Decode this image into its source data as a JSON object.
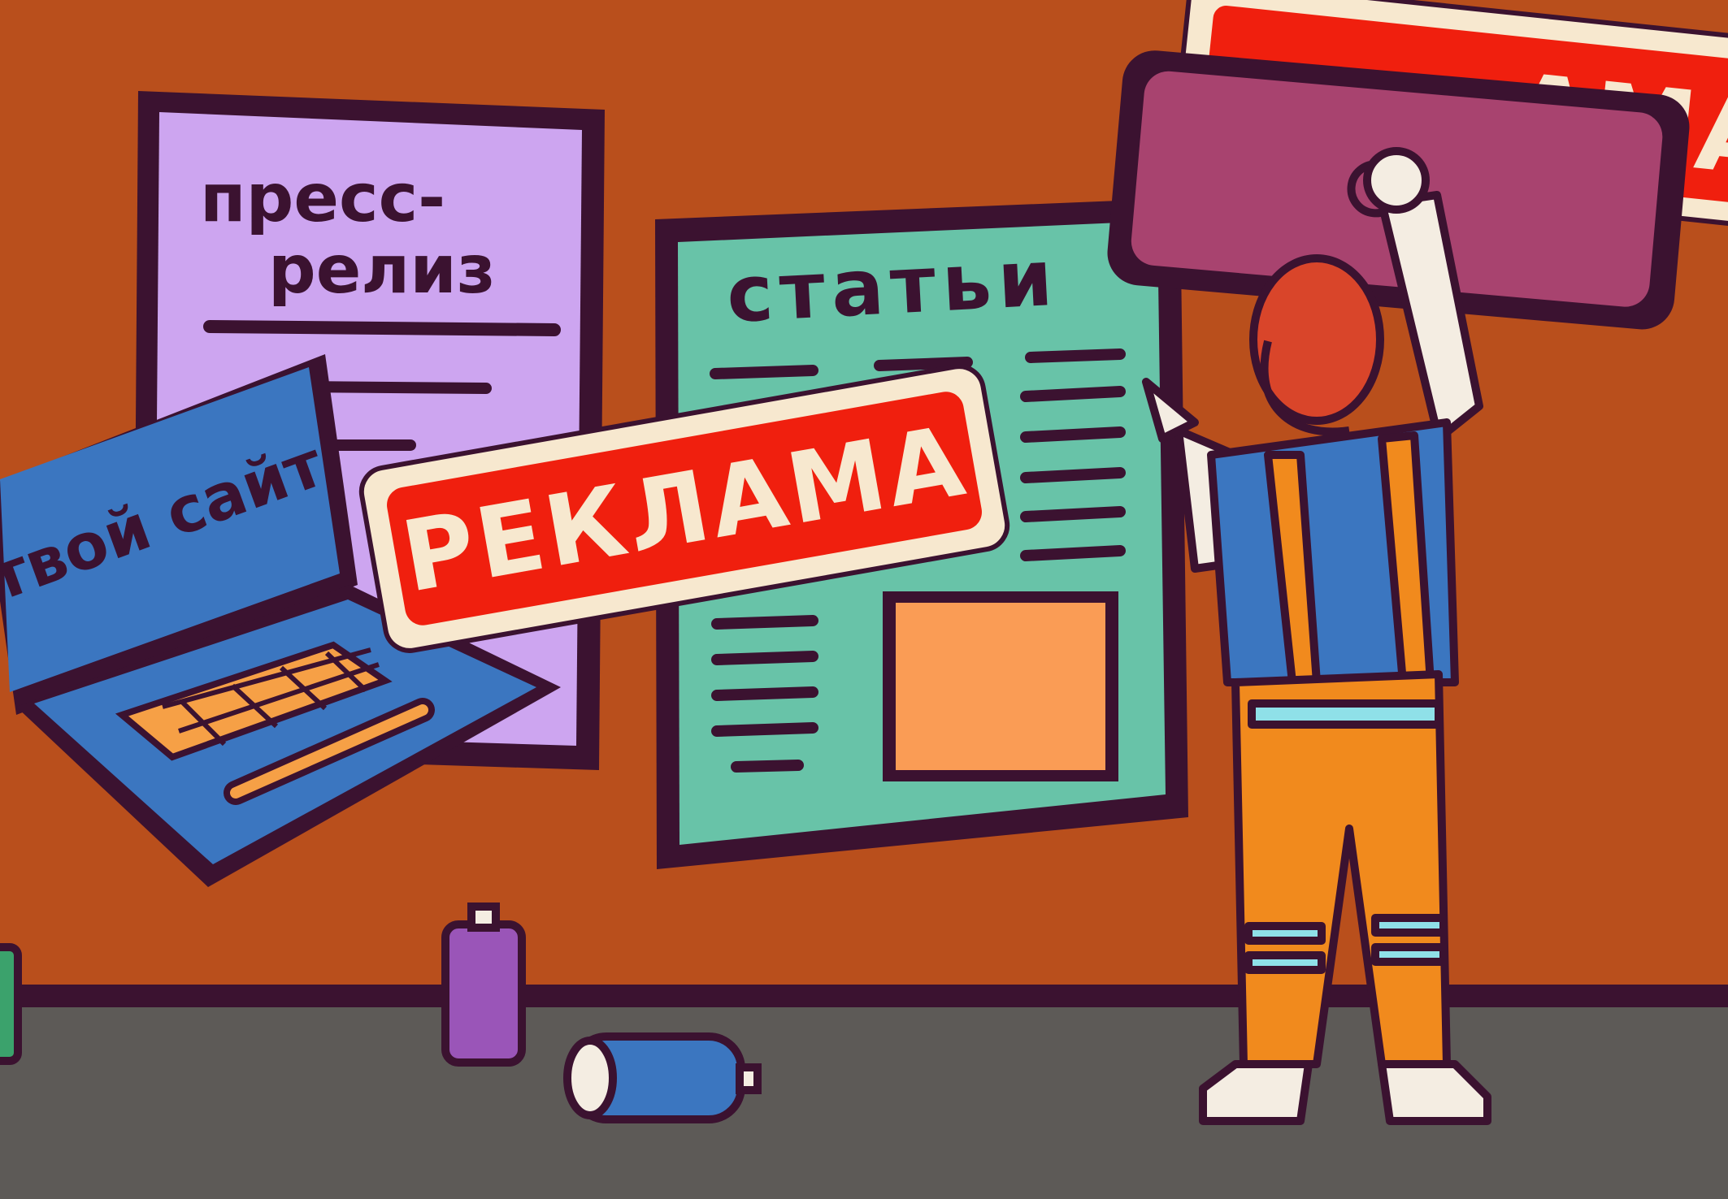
{
  "colors": {
    "wall": "#b94f1c",
    "floor": "#5d5a57",
    "outline": "#3b1230",
    "lilac": "#cda5f0",
    "teal": "#68c3a8",
    "blue": "#3b76c0",
    "red": "#f01f0e",
    "cream": "#f7e8cf",
    "orange": "#f18a1d",
    "plum": "#a8436f"
  },
  "posters": {
    "press_release_line1": "пресс-",
    "press_release_line2": "релиз",
    "articles": "статьи"
  },
  "laptop": {
    "screen_text": "твой сайт"
  },
  "banners": {
    "ad_main": "РЕКЛАМА",
    "ad_top_partial": "АМА"
  },
  "icons": [
    "spray-can-icon",
    "worker-figure",
    "laptop-icon"
  ]
}
